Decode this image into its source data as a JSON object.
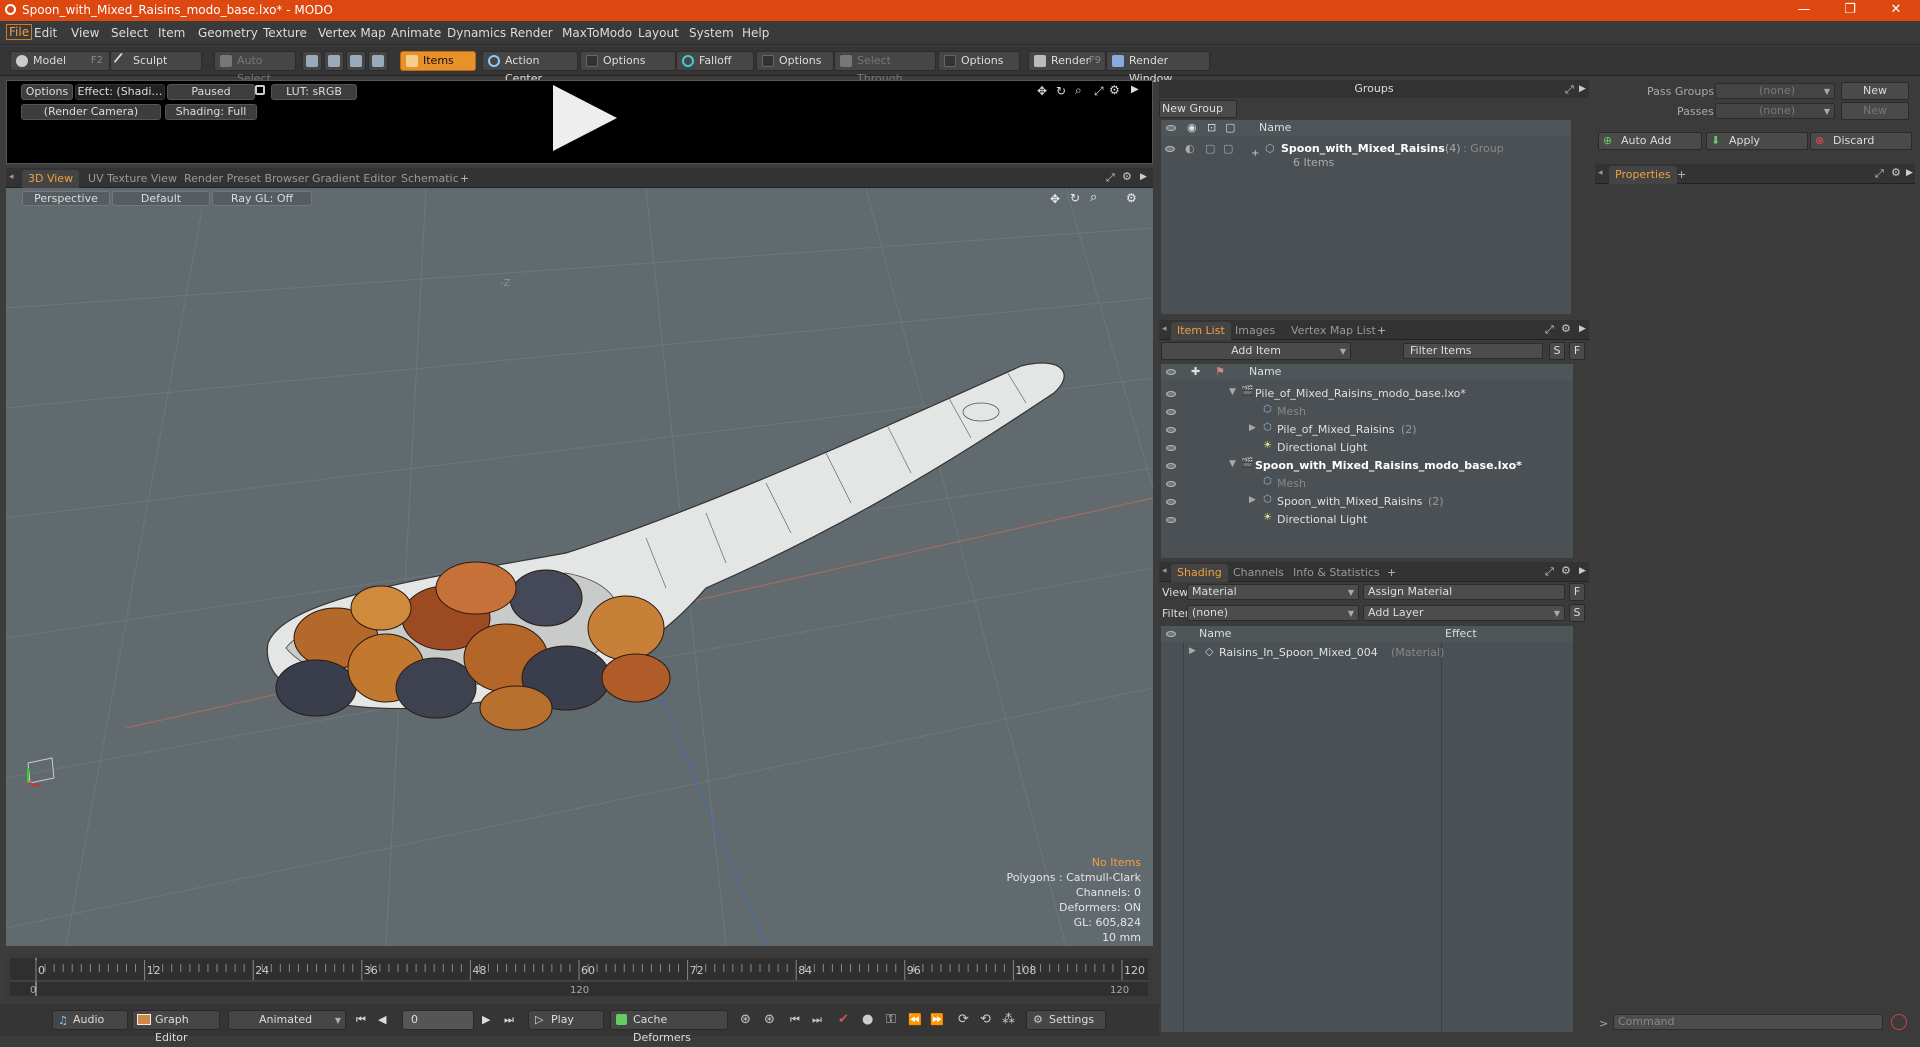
{
  "window": {
    "title": "Spoon_with_Mixed_Raisins_modo_base.lxo* - MODO",
    "minimize": "—",
    "maximize": "❐",
    "close": "✕"
  },
  "menu": [
    "File",
    "Edit",
    "View",
    "Select",
    "Item",
    "Geometry",
    "Texture",
    "Vertex Map",
    "Animate",
    "Dynamics",
    "Render",
    "MaxToModo",
    "Layout",
    "System",
    "Help"
  ],
  "toolbar": {
    "model": "Model",
    "model_key": "F2",
    "sculpt": "Sculpt",
    "auto_select": "Auto Select",
    "items": "Items",
    "action_center": "Action Center",
    "options1": "Options",
    "falloff": "Falloff",
    "options2": "Options",
    "select_through": "Select Through",
    "options3": "Options",
    "render": "Render",
    "render_key": "F9",
    "render_window": "Render Window"
  },
  "preview": {
    "options": "Options",
    "effect": "Effect: (Shadi…",
    "paused": "Paused",
    "lut": "LUT: sRGB",
    "camera": "(Render Camera)",
    "shading": "Shading: Full"
  },
  "view_tabs": [
    "3D View",
    "UV Texture View",
    "Render Preset Browser",
    "Gradient Editor",
    "Schematic",
    "+"
  ],
  "viewport": {
    "perspective": "Perspective",
    "default": "Default",
    "raygl": "Ray GL: Off",
    "axis_label": "-Z",
    "stats": {
      "no_items": "No Items",
      "polygons": "Polygons : Catmull-Clark",
      "channels": "Channels: 0",
      "deformers": "Deformers: ON",
      "gl": "GL: 605,824",
      "unit": "10 mm"
    }
  },
  "timeline": {
    "ticks": [
      "0",
      "12",
      "24",
      "36",
      "48",
      "60",
      "72",
      "84",
      "96",
      "108",
      "120"
    ],
    "sub_left": "0",
    "sub_mid": "120",
    "sub_right": "120"
  },
  "bottombar": {
    "audio": "Audio",
    "graph_editor": "Graph Editor",
    "animated": "Animated",
    "frame": "0",
    "play": "Play",
    "cache_deformers": "Cache Deformers",
    "settings": "Settings"
  },
  "groups": {
    "title": "Groups",
    "new_group": "New Group",
    "col_name": "Name",
    "item_name": "Spoon_with_Mixed_Raisins",
    "item_count": "(4)",
    "item_type": ": Group",
    "item_sub": "6 Items"
  },
  "passes": {
    "pass_groups": "Pass Groups",
    "pass_groups_val": "(none)",
    "passes": "Passes",
    "passes_val": "(none)",
    "new1": "New",
    "new2": "New"
  },
  "actions": {
    "auto_add": "Auto Add",
    "apply": "Apply",
    "discard": "Discard"
  },
  "properties": {
    "tab": "Properties",
    "plus": "+"
  },
  "itemlist": {
    "tabs": [
      "Item List",
      "Images",
      "Vertex Map List",
      "+"
    ],
    "add_item": "Add Item",
    "filter": "Filter Items",
    "s": "S",
    "f": "F",
    "col_name": "Name",
    "rows": [
      {
        "label": "Pile_of_Mixed_Raisins_modo_base.lxo*",
        "count": ""
      },
      {
        "label": "Mesh",
        "count": ""
      },
      {
        "label": "Pile_of_Mixed_Raisins",
        "count": "(2)"
      },
      {
        "label": "Directional Light",
        "count": ""
      },
      {
        "label": "Spoon_with_Mixed_Raisins_modo_base.lxo*",
        "count": ""
      },
      {
        "label": "Mesh",
        "count": ""
      },
      {
        "label": "Spoon_with_Mixed_Raisins",
        "count": "(2)"
      },
      {
        "label": "Directional Light",
        "count": ""
      }
    ]
  },
  "shading": {
    "tabs": [
      "Shading",
      "Channels",
      "Info & Statistics",
      "+"
    ],
    "view_lbl": "View",
    "view_val": "Material",
    "assign": "Assign Material",
    "f": "F",
    "filter_lbl": "Filter",
    "filter_val": "(none)",
    "add_layer": "Add Layer",
    "s": "S",
    "col_name": "Name",
    "col_effect": "Effect",
    "row_name": "Raisins_In_Spoon_Mixed_004",
    "row_type": "(Material)"
  },
  "command": {
    "placeholder": "Command",
    "prompt": ">"
  },
  "colors": {
    "accent": "#e8902a",
    "title": "#dd4710",
    "viewport": "#616a6e"
  }
}
